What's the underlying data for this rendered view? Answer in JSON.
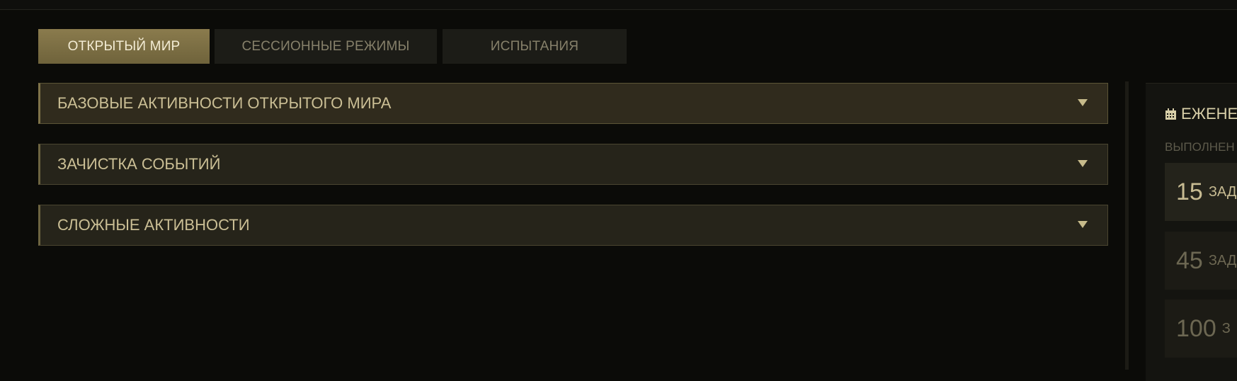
{
  "tabs": [
    {
      "label": "ОТКРЫТЫЙ МИР",
      "active": true
    },
    {
      "label": "СЕССИОННЫЕ РЕЖИМЫ",
      "active": false
    },
    {
      "label": "ИСПЫТАНИЯ",
      "active": false
    }
  ],
  "sections": [
    {
      "label": "БАЗОВЫЕ АКТИВНОСТИ ОТКРЫТОГО МИРА",
      "icon": "chevron-down-icon"
    },
    {
      "label": "ЗАЧИСТКА СОБЫТИЙ",
      "icon": "chevron-down-icon"
    },
    {
      "label": "СЛОЖНЫЕ АКТИВНОСТИ",
      "icon": "chevron-down-icon"
    }
  ],
  "side_panel": {
    "title": "ЕЖЕНЕ",
    "title_icon": "calendar-icon",
    "subtitle": "ВЫПОЛНЕН",
    "tasks": [
      {
        "count": "15",
        "unit": "ЗАД"
      },
      {
        "count": "45",
        "unit": "ЗАД"
      },
      {
        "count": "100",
        "unit": "З"
      }
    ]
  },
  "colors": {
    "background": "#0b0b08",
    "accent": "#7f7349",
    "text_gold": "#cbbf95"
  }
}
